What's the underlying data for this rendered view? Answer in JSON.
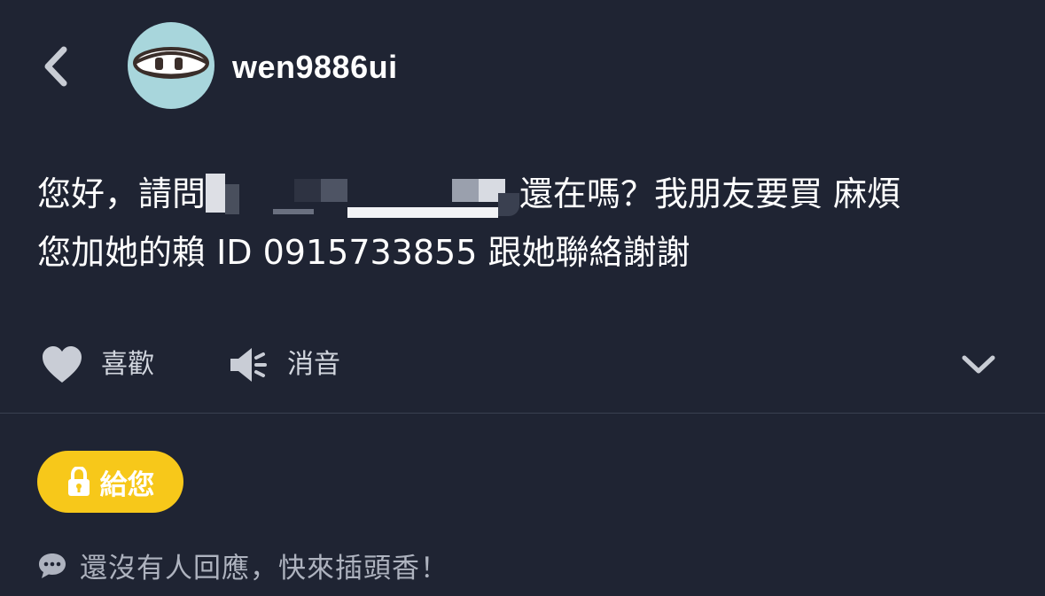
{
  "header": {
    "back_icon": "chevron-left-icon",
    "username": "wen9886ui"
  },
  "post": {
    "line1_before": "您好，請問",
    "line1_after": "還在嗎？我朋友要買 麻煩",
    "line2": "您加她的賴 ID 0915733855 跟她聯絡謝謝"
  },
  "actions": {
    "like_label": "喜歡",
    "mute_label": "消音",
    "expand_icon": "chevron-down-icon"
  },
  "give_button": {
    "label": "給您",
    "icon": "lock-icon",
    "color": "#f7c81a"
  },
  "comments": {
    "empty_text": "還沒有人回應，快來插頭香！",
    "icon": "comment-bubble-icon"
  },
  "colors": {
    "background": "#1f2433",
    "divider": "#3a4050"
  }
}
